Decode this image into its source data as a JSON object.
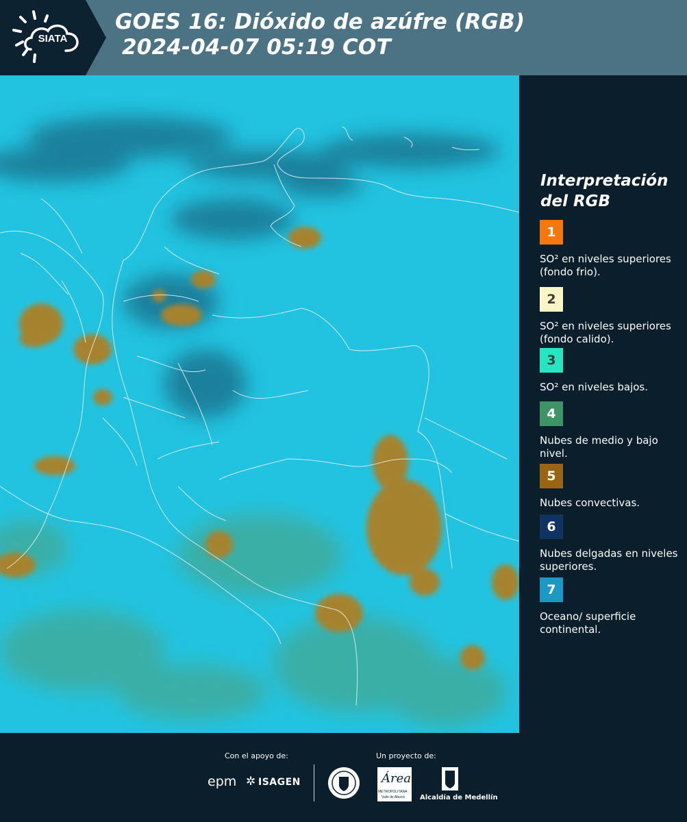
{
  "header": {
    "logo_text": "SIATA",
    "title_line1": "GOES 16: Dióxido de azúfre (RGB)",
    "title_line2": "2024-04-07 05:19 COT"
  },
  "legend": {
    "title_line1": "Interpretación",
    "title_line2": "del RGB",
    "items": [
      {
        "number": "1",
        "color": "#f4780e",
        "label": "SO² en niveles superiores (fondo frio)."
      },
      {
        "number": "2",
        "color": "#fbf6c5",
        "label": "SO² en niveles superiores (fondo calido)."
      },
      {
        "number": "3",
        "color": "#25e6c0",
        "label": "SO² en niveles bajos."
      },
      {
        "number": "4",
        "color": "#3d9467",
        "label": "Nubes de medio y bajo nivel."
      },
      {
        "number": "5",
        "color": "#9a6412",
        "label": "Nubes convectivas."
      },
      {
        "number": "6",
        "color": "#0f3462",
        "label": "Nubes delgadas en niveles superiores."
      },
      {
        "number": "7",
        "color": "#1c98c4",
        "label": "Oceano/ superficie continental."
      }
    ]
  },
  "footer": {
    "support_caption": "Con el apoyo de:",
    "project_caption": "Un proyecto de:",
    "epm_text": "epm",
    "isagen_text": "ISAGEN",
    "area_text": "Área",
    "area_sub1": "METROPOLITANA",
    "area_sub2": "Valle de Aburrá",
    "alcaldia_text": "Alcaldía de Medellín"
  },
  "colors": {
    "header_bg": "#4b7384",
    "logo_bg": "#0d2230",
    "page_bg": "#0b1e2b",
    "map_cyan": "#22c3e0",
    "cloud_brown": "#a5832f",
    "border_line": "#e6eef2"
  }
}
